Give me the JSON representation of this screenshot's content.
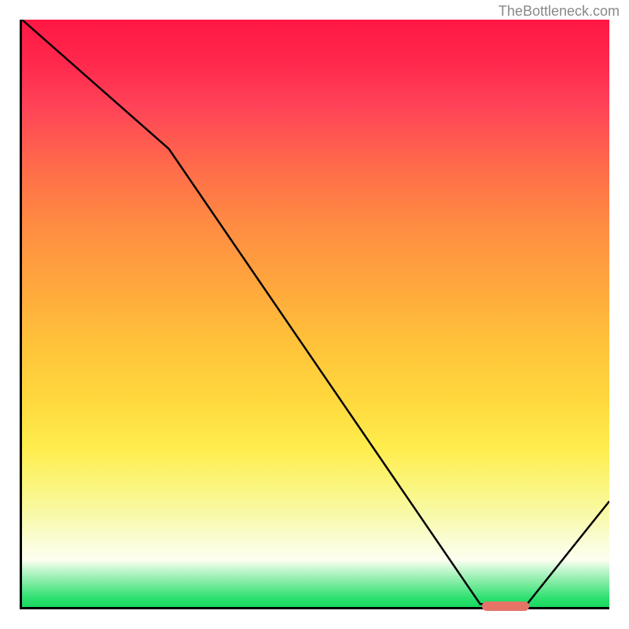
{
  "watermark": "TheBottleneck.com",
  "chart_data": {
    "type": "line",
    "title": "",
    "xlabel": "",
    "ylabel": "",
    "xlim": [
      0,
      100
    ],
    "ylim": [
      0,
      100
    ],
    "x": [
      0,
      25,
      78,
      86,
      100
    ],
    "values": [
      100,
      78,
      0.5,
      0.5,
      18
    ],
    "marker": {
      "x_start": 78,
      "x_end": 86,
      "y": 0.5
    },
    "gradient_colors": {
      "top": "#ff1744",
      "mid_upper": "#ff8c42",
      "mid": "#ffd93d",
      "mid_lower": "#faf682",
      "bottom": "#18d85e"
    }
  }
}
